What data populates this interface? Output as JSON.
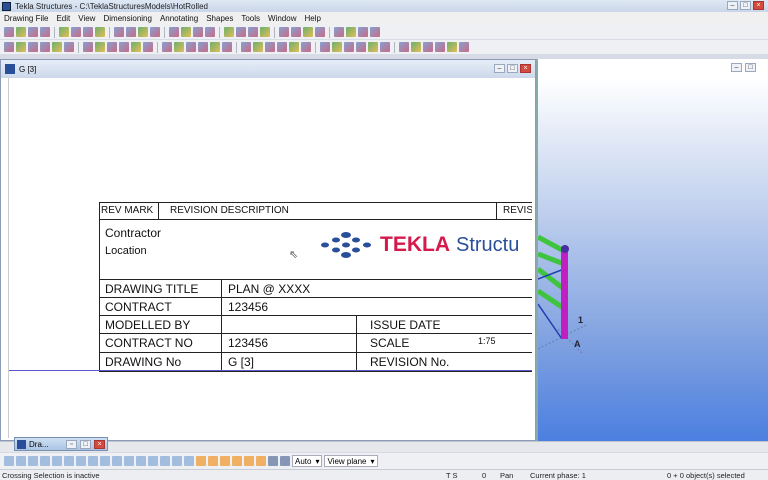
{
  "window": {
    "title": "Tekla Structures - C:\\TeklaStructuresModels\\HotRolled"
  },
  "menu": [
    "Drawing File",
    "Edit",
    "View",
    "Dimensioning",
    "Annotating",
    "Shapes",
    "Tools",
    "Window",
    "Help"
  ],
  "toolbar1": {
    "icon_count": 28
  },
  "toolbar2": {
    "icon_count": 36
  },
  "drawing_window": {
    "title": "G  [3]"
  },
  "title_block": {
    "rev_mark": "REV MARK",
    "revision_description": "REVISION DESCRIPTION",
    "revis": "REVIS",
    "contractor": "Contractor",
    "location": "Location",
    "logo": {
      "brand": "TEKLA",
      "product": "Structu",
      "brand_color": "#d6194b",
      "product_color": "#2a4f9a"
    },
    "rows": [
      {
        "label": "DRAWING TITLE",
        "value": "PLAN @ XXXX"
      },
      {
        "label": "CONTRACT",
        "value": "123456"
      },
      {
        "label": "MODELLED BY",
        "value": "",
        "label2": "ISSUE DATE",
        "value2": ""
      },
      {
        "label": "CONTRACT NO",
        "value": "123456",
        "label2": "SCALE",
        "value2": "1:75"
      },
      {
        "label": "DRAWING No",
        "value": "G   [3]",
        "label2": "REVISION No.",
        "value2": ""
      }
    ]
  },
  "view3d": {
    "grid_labels": [
      "1",
      "A"
    ]
  },
  "minimized_window": {
    "title": "Dra..."
  },
  "bottom_toolbar": {
    "select_mode": "Auto",
    "view_plane": "View plane"
  },
  "status": {
    "message": "Crossing Selection is inactive",
    "ts": "T S",
    "zero": "0",
    "mode": "Pan",
    "phase": "Current phase: 1",
    "selected": "0 + 0 object(s) selected"
  }
}
